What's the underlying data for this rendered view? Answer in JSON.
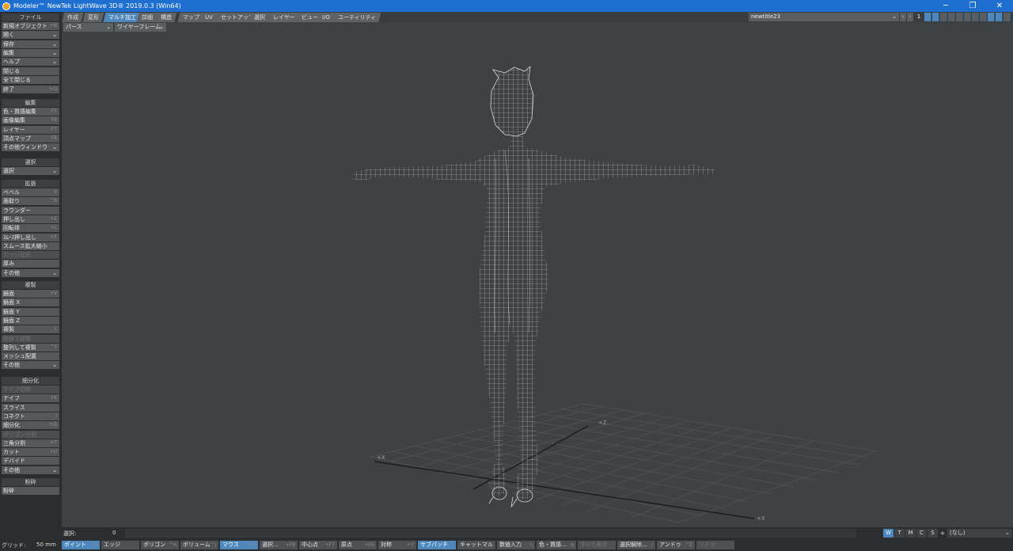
{
  "window": {
    "title": "Modeler™ NewTek LightWave 3D® 2019.0.3 (Win64)",
    "min_glyph": "─",
    "max_glyph": "❐",
    "close_glyph": "✕"
  },
  "tabs": [
    "作成",
    "変形",
    "マルチ加工",
    "詳細",
    "構造",
    "マップ",
    "UV",
    "セットアップ",
    "選択",
    "レイヤー",
    "ビュー",
    "I/O",
    "ユーティリティ"
  ],
  "active_tab": "マルチ加工",
  "layer": {
    "object_name": "newtitle23",
    "number": "1",
    "prev_glyph": "‹",
    "next_glyph": "›"
  },
  "view": {
    "projection": "パース",
    "render_mode": "ワイヤーフレーム",
    "axis_z": "+Z",
    "axis_x_left": "+X",
    "axis_x_right": "+X"
  },
  "sidebar": {
    "file_header": "ファイル",
    "file_items": [
      {
        "label": "新規オブジェクト",
        "shortcut": "+N"
      },
      {
        "label": "開く",
        "dropdown": "⌄"
      },
      {
        "label": "保存",
        "dropdown": "⌄"
      },
      {
        "label": "編集",
        "dropdown": "⌄"
      },
      {
        "label": "ヘルプ",
        "dropdown": "⌄"
      }
    ],
    "close_items": [
      {
        "label": "閉じる",
        "shortcut": ""
      },
      {
        "label": "全て閉じる",
        "shortcut": ""
      },
      {
        "label": "終了",
        "shortcut": "+Q"
      }
    ],
    "edit_header": "編集",
    "edit_items": [
      {
        "label": "色・質感編集",
        "shortcut": "F5"
      },
      {
        "label": "画像編集",
        "shortcut": "F6"
      },
      {
        "label": "レイヤー",
        "shortcut": "F7"
      },
      {
        "label": "頂点マップ",
        "shortcut": "F8"
      },
      {
        "label": "その他ウィンドウ",
        "dropdown": "⌄"
      }
    ],
    "select_header": "選択",
    "select_items": [
      {
        "label": "選択",
        "dropdown": "⌄"
      }
    ],
    "extend_header": "拡張",
    "extend_items": [
      {
        "label": "ベベル",
        "shortcut": "b"
      },
      {
        "label": "面取り",
        "shortcut": "^B"
      },
      {
        "label": "ラウンダー",
        "shortcut": ""
      },
      {
        "label": "押し出し",
        "shortcut": "+E"
      },
      {
        "label": "回転体",
        "shortcut": "+L"
      },
      {
        "label": "ｽﾑｰｽ押し出し",
        "shortcut": "+F"
      },
      {
        "label": "スムース拡大縮小",
        "shortcut": ""
      },
      {
        "label": "エッジ延長",
        "shortcut": "",
        "dim": true
      },
      {
        "label": "厚み",
        "shortcut": ""
      },
      {
        "label": "その他",
        "dropdown": "⌄"
      }
    ],
    "duplicate_header": "複製",
    "duplicate_items": [
      {
        "label": "鏡面",
        "shortcut": "+V"
      },
      {
        "label": "鏡面 X",
        "shortcut": ""
      },
      {
        "label": "鏡面 Y",
        "shortcut": ""
      },
      {
        "label": "鏡面 Z",
        "shortcut": ""
      },
      {
        "label": "複製",
        "shortcut": "c"
      },
      {
        "label": "曲線で複製",
        "shortcut": "",
        "dim": true
      },
      {
        "label": "整列して複製",
        "shortcut": "^Y"
      },
      {
        "label": "メッシュ配置",
        "shortcut": ""
      },
      {
        "label": "その他",
        "dropdown": "⌄"
      }
    ],
    "subdivide_header": "細分化",
    "subdivide_items": [
      {
        "label": "ナイフ切断",
        "shortcut": "",
        "dim": true
      },
      {
        "label": "ナイフ",
        "shortcut": "+K"
      },
      {
        "label": "スライス",
        "shortcut": ""
      },
      {
        "label": "コネクト",
        "shortcut": "i"
      },
      {
        "label": "細分化",
        "shortcut": "+D"
      },
      {
        "label": "ポリゴン分割",
        "shortcut": "",
        "dim": true
      },
      {
        "label": "三角分割",
        "shortcut": "+T"
      },
      {
        "label": "カット",
        "shortcut": "+U"
      },
      {
        "label": "デバイド",
        "shortcut": ""
      },
      {
        "label": "その他",
        "dropdown": "⌄"
      }
    ],
    "crush_header": "粉砕",
    "crush_items": [
      {
        "label": "粉砕",
        "shortcut": ""
      }
    ]
  },
  "statusbar": {
    "selection_label": "選択:",
    "selection_value": "0",
    "view_modes": [
      "W",
      "T",
      "M",
      "C",
      "S"
    ],
    "active_view_mode": "W",
    "add_glyph": "+",
    "none_label": "(なし)"
  },
  "bottombar": {
    "grid_label": "グリッド:",
    "grid_value": "50 mm",
    "buttons": [
      {
        "label": "ポイント",
        "shortcut": "^G",
        "active": true
      },
      {
        "label": "エッジ",
        "shortcut": ""
      },
      {
        "label": "ポリゴン",
        "shortcut": "^H"
      },
      {
        "label": "ボリューム",
        "shortcut": "^J"
      },
      {
        "label": "マウス",
        "shortcut": "+F3",
        "active": true
      },
      {
        "label": "選択…",
        "shortcut": "+F8"
      },
      {
        "label": "中心点",
        "shortcut": "+F7"
      },
      {
        "label": "原点",
        "shortcut": "+F6"
      },
      {
        "label": "対称",
        "shortcut": "+Y"
      },
      {
        "label": "サブパッチ",
        "shortcut": "",
        "active": true
      },
      {
        "label": "キャットマル",
        "shortcut": ""
      },
      {
        "label": "数値入力",
        "shortcut": "n"
      },
      {
        "label": "色・質感…",
        "shortcut": "q"
      },
      {
        "label": "すべて表示",
        "shortcut": "",
        "dim": true
      },
      {
        "label": "選択解除…",
        "shortcut": "/"
      },
      {
        "label": "アンドゥ",
        "shortcut": "^Z"
      },
      {
        "label": "リドゥ",
        "shortcut": "",
        "dim": true
      }
    ]
  },
  "colors": {
    "titlebar": "#1f6fd1",
    "accent": "#4d87bb",
    "viewport": "#3f4245",
    "wire": "#c8c8c8",
    "grid": "#4a4d50"
  },
  "icons": [
    "app-icon",
    "move-view-icon",
    "rotate-view-icon",
    "zoom-view-icon",
    "maximize-view-icon"
  ]
}
